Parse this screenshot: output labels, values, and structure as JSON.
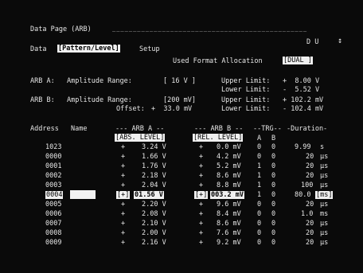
{
  "header": {
    "title": "Data Page (ARB)",
    "title_dashes": "_______________________________________________",
    "du_label": "D U",
    "scroll_symbol": "↕"
  },
  "setup": {
    "label_prefix": "Data",
    "mode": "[Pattern/Level]",
    "label_suffix": "Setup",
    "allocation_label": "Used Format Allocation",
    "allocation_value": "[DUAL ]"
  },
  "arb_a": {
    "label": "ARB A:",
    "range_label": "Amplitude Range:",
    "range_value": "[ 16 V ]",
    "upper_label": "Upper Limit:",
    "upper_value": "+  8.00 V",
    "lower_label": "Lower Limit:",
    "lower_value": "-  5.52 V"
  },
  "arb_b": {
    "label": "ARB B:",
    "range_label": "Amplitude Range:",
    "range_value": "[200 mV]",
    "offset_label": "Offset:",
    "offset_value": "+  33.0 mV",
    "upper_label": "Upper Limit:",
    "upper_value": "+ 102.2 mV",
    "lower_label": "Lower Limit:",
    "lower_value": "- 102.4 mV"
  },
  "table": {
    "headers": {
      "address": "Address",
      "name": "Name",
      "arb_a": "--- ARB A --",
      "arb_b": "--- ARB B -- ",
      "trg": "--TRG--",
      "duration": "-Duration-"
    },
    "subheaders": {
      "arb_a_mode": "[ABS. LEVEL]",
      "arb_b_mode": "[REL. LEVEL]",
      "trg_a": "A",
      "trg_b": "B"
    },
    "rows": [
      {
        "address": "1023",
        "sign_a": "+",
        "val_a": "3.24 V",
        "sign_b": "+",
        "val_b": "0.0 mV",
        "trg_a": "0",
        "trg_b": "0",
        "dur": "9.99",
        "unit": "s"
      },
      {
        "address": "0000",
        "sign_a": "+",
        "val_a": "1.66 V",
        "sign_b": "+",
        "val_b": "4.2 mV",
        "trg_a": "0",
        "trg_b": "0",
        "dur": "20",
        "unit": "μs"
      },
      {
        "address": "0001",
        "sign_a": "+",
        "val_a": "1.76 V",
        "sign_b": "+",
        "val_b": "5.2 mV",
        "trg_a": "1",
        "trg_b": "0",
        "dur": "20",
        "unit": "μs"
      },
      {
        "address": "0002",
        "sign_a": "+",
        "val_a": "2.18 V",
        "sign_b": "+",
        "val_b": "8.6 mV",
        "trg_a": "1",
        "trg_b": "0",
        "dur": "20",
        "unit": "μs"
      },
      {
        "address": "0003",
        "sign_a": "+",
        "val_a": "2.04 V",
        "sign_b": "+",
        "val_b": "8.8 mV",
        "trg_a": "1",
        "trg_b": "0",
        "dur": "100",
        "unit": "μs"
      },
      {
        "address": "0004",
        "sign_a": "[+]",
        "val_a": "01.56 V",
        "sign_b": "[+]",
        "val_b": "003.2 mV",
        "trg_a": "1",
        "trg_b": "0",
        "dur": "80.0",
        "unit": "[ms]"
      },
      {
        "address": "0005",
        "sign_a": "+",
        "val_a": "2.20 V",
        "sign_b": "+",
        "val_b": "9.6 mV",
        "trg_a": "0",
        "trg_b": "0",
        "dur": "20",
        "unit": "μs"
      },
      {
        "address": "0006",
        "sign_a": "+",
        "val_a": "2.08 V",
        "sign_b": "+",
        "val_b": "8.4 mV",
        "trg_a": "0",
        "trg_b": "0",
        "dur": "1.0",
        "unit": "ms"
      },
      {
        "address": "0007",
        "sign_a": "+",
        "val_a": "2.10 V",
        "sign_b": "+",
        "val_b": "8.6 mV",
        "trg_a": "0",
        "trg_b": "0",
        "dur": "20",
        "unit": "μs"
      },
      {
        "address": "0008",
        "sign_a": "+",
        "val_a": "2.00 V",
        "sign_b": "+",
        "val_b": "7.6 mV",
        "trg_a": "0",
        "trg_b": "0",
        "dur": "20",
        "unit": "μs"
      },
      {
        "address": "0009",
        "sign_a": "+",
        "val_a": "2.16 V",
        "sign_b": "+",
        "val_b": "9.2 mV",
        "trg_a": "0",
        "trg_b": "0",
        "dur": "20",
        "unit": "μs"
      }
    ],
    "selected_row": 5
  }
}
